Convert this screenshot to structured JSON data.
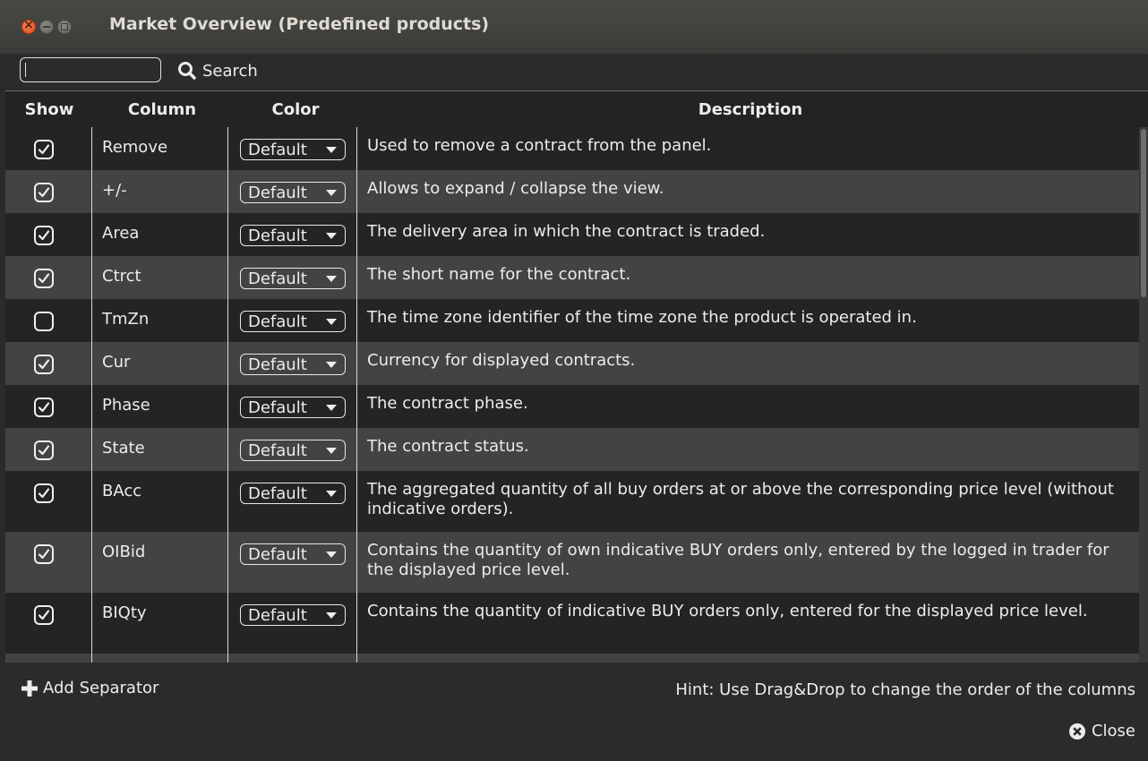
{
  "window": {
    "title": "Market Overview (Predefined products)"
  },
  "search": {
    "value": "",
    "button_label": "Search"
  },
  "table": {
    "headers": {
      "show": "Show",
      "column": "Column",
      "color": "Color",
      "description": "Description"
    },
    "rows": [
      {
        "show": true,
        "column": "Remove",
        "color": "Default",
        "description": "Used to remove a contract from the panel."
      },
      {
        "show": true,
        "column": "+/-",
        "color": "Default",
        "description": "Allows to expand / collapse the view."
      },
      {
        "show": true,
        "column": "Area",
        "color": "Default",
        "description": "The delivery area in which the contract is traded."
      },
      {
        "show": true,
        "column": "Ctrct",
        "color": "Default",
        "description": "The short name for the contract."
      },
      {
        "show": false,
        "column": "TmZn",
        "color": "Default",
        "description": "The time zone identifier of the time zone the product is operated in."
      },
      {
        "show": true,
        "column": "Cur",
        "color": "Default",
        "description": "Currency for displayed contracts."
      },
      {
        "show": true,
        "column": "Phase",
        "color": "Default",
        "description": "The contract phase."
      },
      {
        "show": true,
        "column": "State",
        "color": "Default",
        "description": "The contract status."
      },
      {
        "show": true,
        "column": "BAcc",
        "color": "Default",
        "description": "The aggregated quantity of all buy orders at or above the corresponding price level (without indicative orders)."
      },
      {
        "show": true,
        "column": "OIBid",
        "color": "Default",
        "description": "Contains the quantity of own indicative BUY orders only, entered by the logged in trader for the displayed price level."
      },
      {
        "show": true,
        "column": "BIQty",
        "color": "Default",
        "description": "Contains the quantity of indicative BUY orders only, entered for the displayed price level."
      }
    ]
  },
  "footer": {
    "add_separator_label": "Add Separator",
    "hint": "Hint: Use Drag&Drop to change the order of the columns",
    "close_label": "Close"
  },
  "colors": {
    "row_dark": "#242424",
    "row_light": "#434343",
    "accent_close": "#df4b16"
  }
}
